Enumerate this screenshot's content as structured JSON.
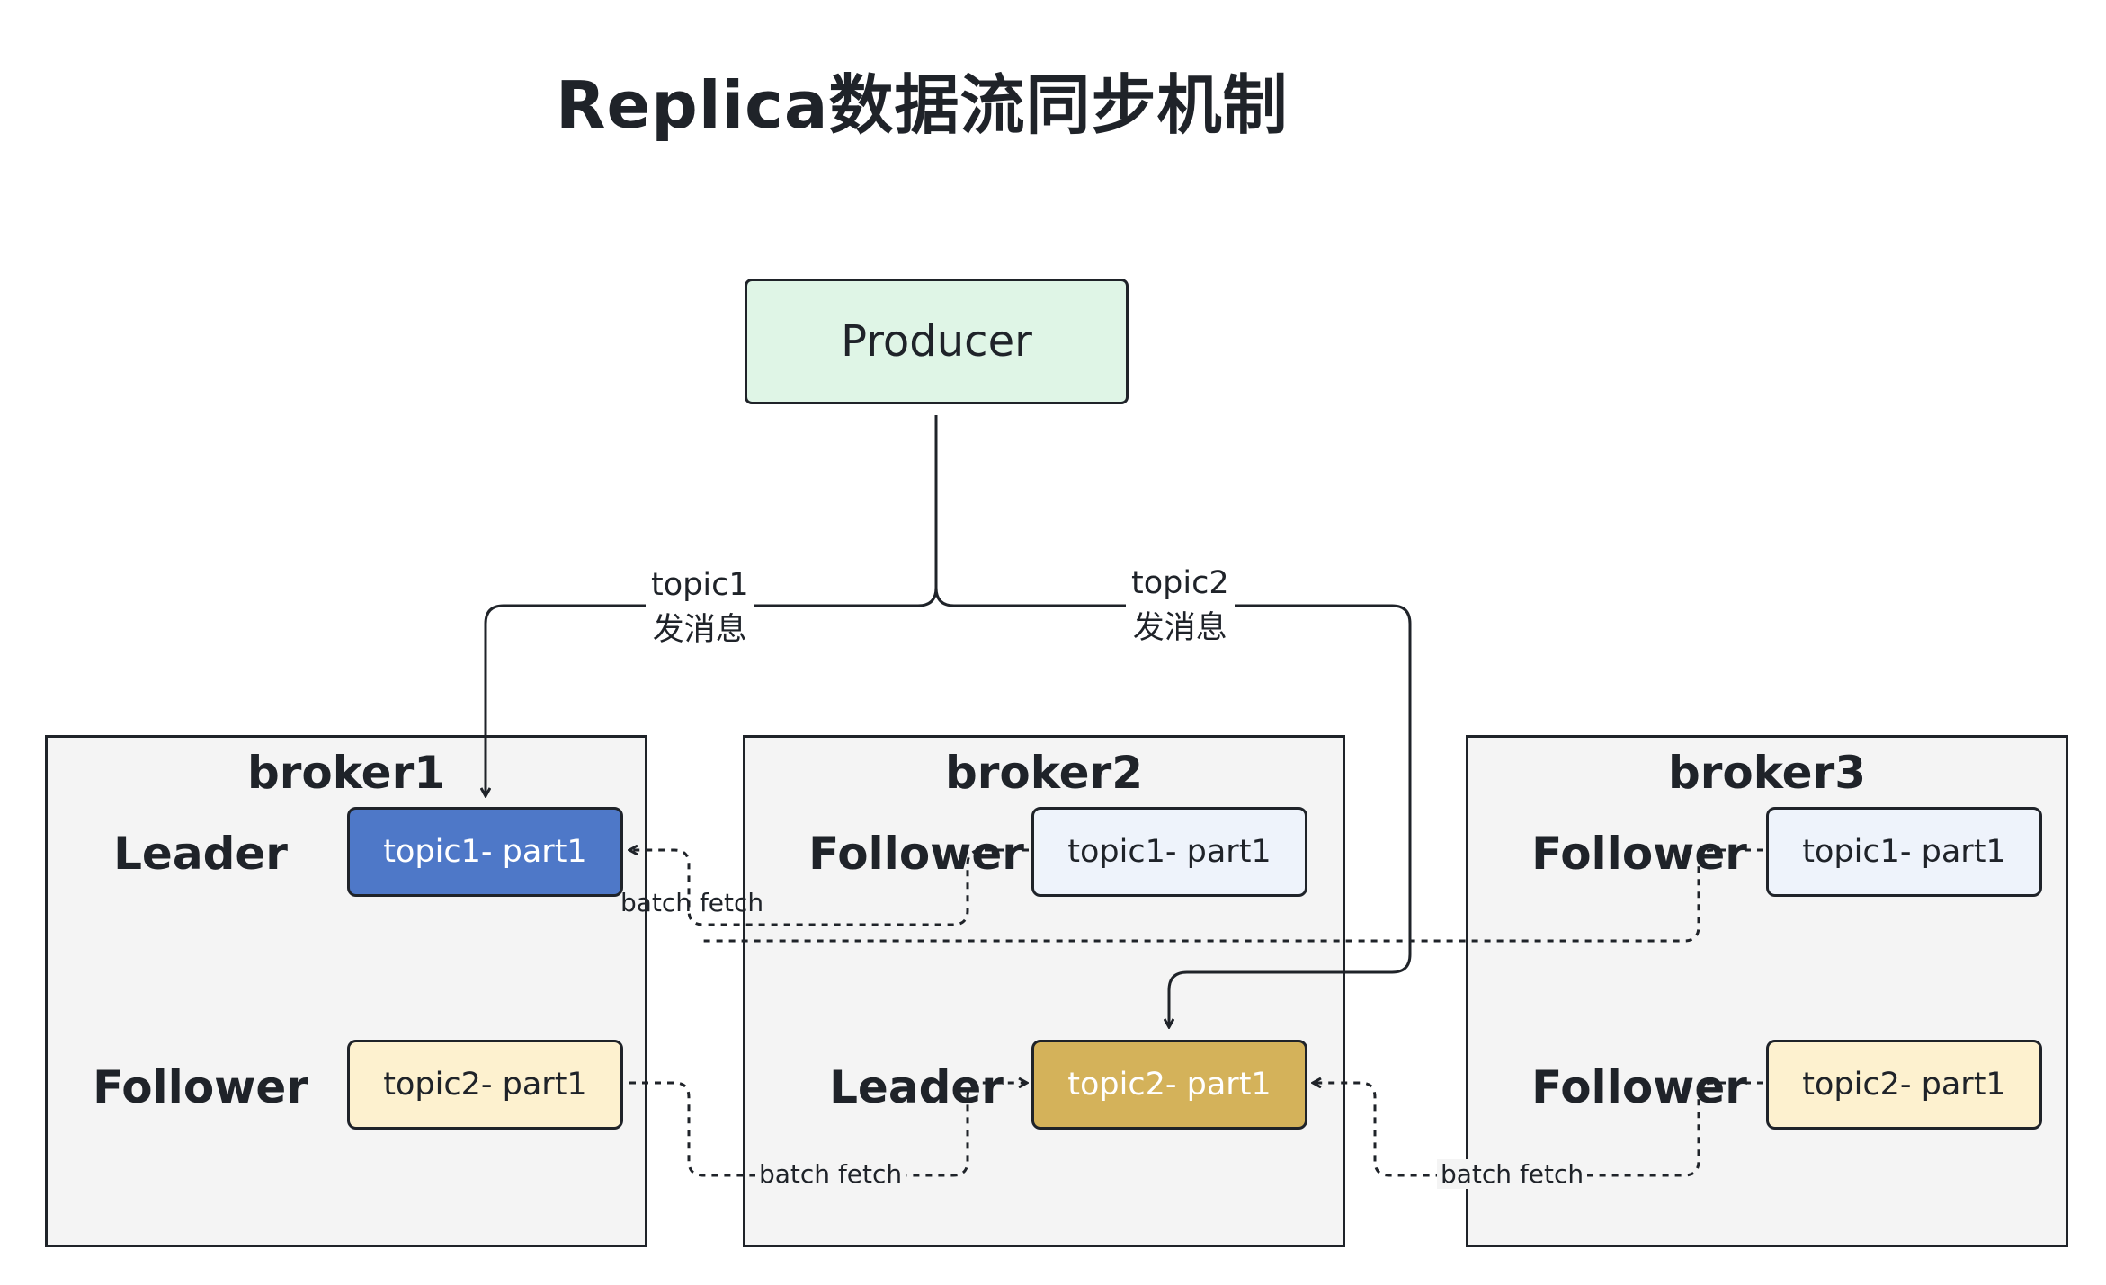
{
  "title": "Replica数据流同步机制",
  "producer": {
    "label": "Producer"
  },
  "edges": {
    "topic1": {
      "line1": "topic1",
      "line2": "发消息"
    },
    "topic2": {
      "line1": "topic2",
      "line2": "发消息"
    }
  },
  "fetch_label": "batch fetch",
  "brokers": [
    {
      "name": "broker1",
      "rows": [
        {
          "role": "Leader",
          "partition": "topic1- part1",
          "style": "leader-topic1"
        },
        {
          "role": "Follower",
          "partition": "topic2- part1",
          "style": "follower-topic2"
        }
      ]
    },
    {
      "name": "broker2",
      "rows": [
        {
          "role": "Follower",
          "partition": "topic1- part1",
          "style": "follower-topic1"
        },
        {
          "role": "Leader",
          "partition": "topic2- part1",
          "style": "leader-topic2"
        }
      ]
    },
    {
      "name": "broker3",
      "rows": [
        {
          "role": "Follower",
          "partition": "topic1- part1",
          "style": "follower-topic1"
        },
        {
          "role": "Follower",
          "partition": "topic2- part1",
          "style": "follower-topic2"
        }
      ]
    }
  ],
  "colors": {
    "producer_fill": "#dff5e6",
    "broker_fill": "#f4f4f4",
    "leader_topic1_fill": "#4e78c8",
    "leader_topic2_fill": "#d4b25a",
    "follower_topic1_fill": "#eef3fb",
    "follower_topic2_fill": "#fdf1cf",
    "stroke": "#1f2329"
  }
}
